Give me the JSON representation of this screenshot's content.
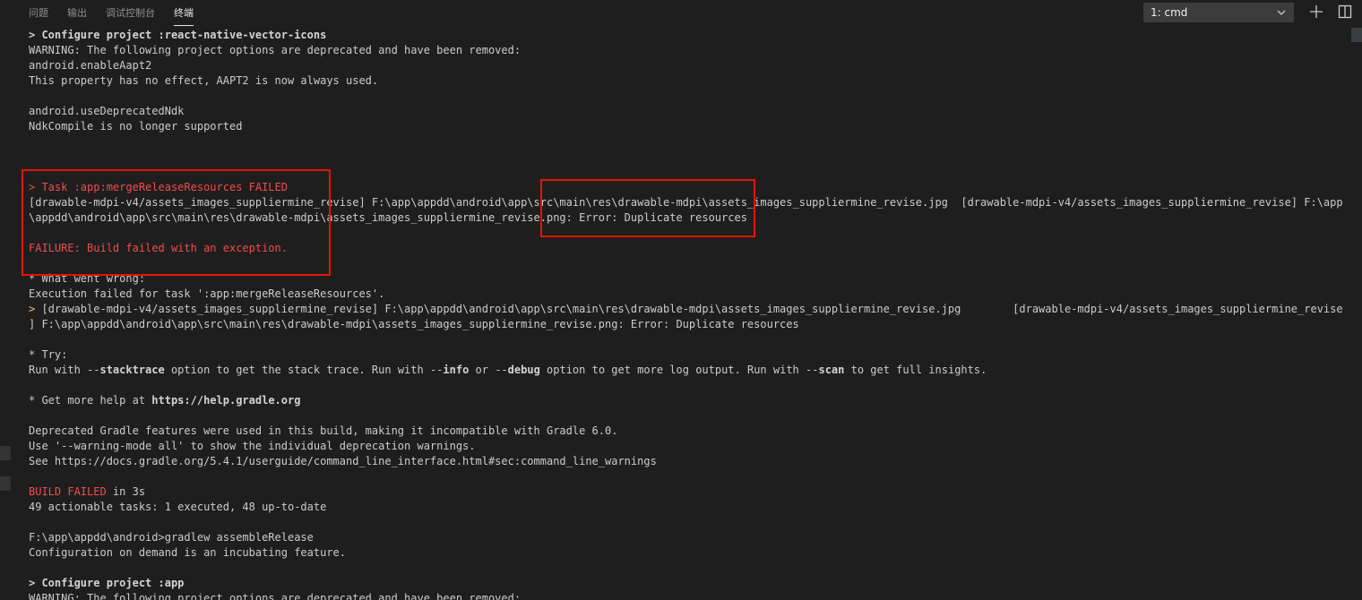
{
  "panel": {
    "tabs": [
      {
        "label": "问题",
        "active": false
      },
      {
        "label": "输出",
        "active": false
      },
      {
        "label": "调试控制台",
        "active": false
      },
      {
        "label": "终端",
        "active": true
      }
    ],
    "terminal_selector": {
      "value": "1: cmd",
      "icon": "chevron-down-icon"
    },
    "actions": [
      {
        "name": "new-terminal-button",
        "icon": "plus-icon"
      },
      {
        "name": "split-terminal-button",
        "icon": "split-icon"
      }
    ]
  },
  "colors": {
    "background": "#1e1e1e",
    "text": "#cccccc",
    "error": "#f14c4c",
    "highlight_box": "#e51400"
  },
  "terminal": {
    "lines": [
      {
        "segments": [
          {
            "text": "> Configure project :react-native-vector-icons",
            "style": "b"
          }
        ]
      },
      {
        "segments": [
          {
            "text": "WARNING: The following project options are deprecated and have been removed:"
          }
        ]
      },
      {
        "segments": [
          {
            "text": "android.enableAapt2"
          }
        ]
      },
      {
        "segments": [
          {
            "text": "This property has no effect, AAPT2 is now always used."
          }
        ]
      },
      {
        "segments": [
          {
            "text": ""
          }
        ]
      },
      {
        "segments": [
          {
            "text": "android.useDeprecatedNdk"
          }
        ]
      },
      {
        "segments": [
          {
            "text": "NdkCompile is no longer supported"
          }
        ]
      },
      {
        "segments": [
          {
            "text": ""
          }
        ]
      },
      {
        "segments": [
          {
            "text": ""
          }
        ]
      },
      {
        "segments": [
          {
            "text": ""
          }
        ]
      },
      {
        "segments": [
          {
            "text": "> Task :app:mergeReleaseResources FAILED",
            "style": "red"
          }
        ]
      },
      {
        "segments": [
          {
            "text": "[drawable-mdpi-v4/assets_images_suppliermine_revise] F:\\app\\appdd\\android\\app\\src\\main\\res\\drawable-mdpi\\assets_images_suppliermine_revise.jpg  [drawable-mdpi-v4/assets_images_suppliermine_revise] F:\\app"
          }
        ]
      },
      {
        "segments": [
          {
            "text": "\\appdd\\android\\app\\src\\main\\res\\drawable-mdpi\\assets_images_suppliermine_revise.png: Error: Duplicate resources"
          }
        ]
      },
      {
        "segments": [
          {
            "text": ""
          }
        ]
      },
      {
        "segments": [
          {
            "text": "FAILURE: Build failed with an exception.",
            "style": "red"
          }
        ]
      },
      {
        "segments": [
          {
            "text": ""
          }
        ]
      },
      {
        "segments": [
          {
            "text": "* What went wrong:"
          }
        ]
      },
      {
        "segments": [
          {
            "text": "Execution failed for task ':app:mergeReleaseResources'."
          }
        ]
      },
      {
        "segments": [
          {
            "text": "> ",
            "style": "gold"
          },
          {
            "text": "[drawable-mdpi-v4/assets_images_suppliermine_revise] F:\\app\\appdd\\android\\app\\src\\main\\res\\drawable-mdpi\\assets_images_suppliermine_revise.jpg        [drawable-mdpi-v4/assets_images_suppliermine_revise"
          }
        ]
      },
      {
        "segments": [
          {
            "text": "] F:\\app\\appdd\\android\\app\\src\\main\\res\\drawable-mdpi\\assets_images_suppliermine_revise.png: Error: Duplicate resources"
          }
        ]
      },
      {
        "segments": [
          {
            "text": ""
          }
        ]
      },
      {
        "segments": [
          {
            "text": "* Try:"
          }
        ]
      },
      {
        "segments": [
          {
            "text": "Run with --"
          },
          {
            "text": "stacktrace",
            "style": "b"
          },
          {
            "text": " option to get the stack trace. Run with --"
          },
          {
            "text": "info",
            "style": "b"
          },
          {
            "text": " or --"
          },
          {
            "text": "debug",
            "style": "b"
          },
          {
            "text": " option to get more log output. Run with --"
          },
          {
            "text": "scan",
            "style": "b"
          },
          {
            "text": " to get full insights."
          }
        ]
      },
      {
        "segments": [
          {
            "text": ""
          }
        ]
      },
      {
        "segments": [
          {
            "text": "* Get more help at "
          },
          {
            "text": "https://help.gradle.org",
            "style": "b"
          }
        ]
      },
      {
        "segments": [
          {
            "text": ""
          }
        ]
      },
      {
        "segments": [
          {
            "text": "Deprecated Gradle features were used in this build, making it incompatible with Gradle 6.0."
          }
        ]
      },
      {
        "segments": [
          {
            "text": "Use '--warning-mode all' to show the individual deprecation warnings."
          }
        ]
      },
      {
        "segments": [
          {
            "text": "See https://docs.gradle.org/5.4.1/userguide/command_line_interface.html#sec:command_line_warnings"
          }
        ]
      },
      {
        "segments": [
          {
            "text": ""
          }
        ]
      },
      {
        "segments": [
          {
            "text": "BUILD FAILED",
            "style": "red"
          },
          {
            "text": " in 3s"
          }
        ]
      },
      {
        "segments": [
          {
            "text": "49 actionable tasks: 1 executed, 48 up-to-date"
          }
        ]
      },
      {
        "segments": [
          {
            "text": ""
          }
        ]
      },
      {
        "segments": [
          {
            "text": "F:\\app\\appdd\\android>gradlew assembleRelease"
          }
        ]
      },
      {
        "segments": [
          {
            "text": "Configuration on demand is an incubating feature."
          }
        ]
      },
      {
        "segments": [
          {
            "text": ""
          }
        ]
      },
      {
        "segments": [
          {
            "text": "> Configure project :app",
            "style": "b"
          }
        ]
      },
      {
        "segments": [
          {
            "text": "WARNING: The following project options are deprecated and have been removed:"
          }
        ]
      }
    ]
  }
}
